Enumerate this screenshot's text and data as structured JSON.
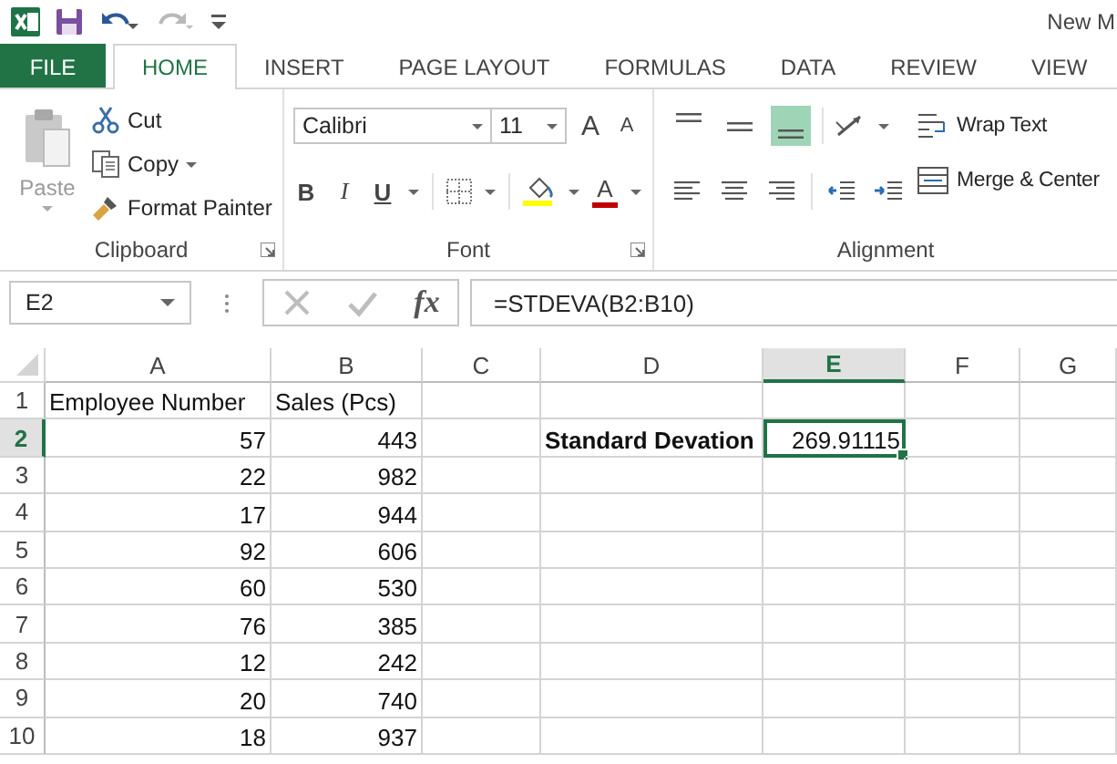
{
  "window": {
    "title": "New M",
    "redo_disabled": true
  },
  "tabs": [
    {
      "label": "FILE",
      "kind": "file",
      "selected": false
    },
    {
      "label": "HOME",
      "kind": "tab",
      "selected": true
    },
    {
      "label": "INSERT",
      "kind": "tab",
      "selected": false
    },
    {
      "label": "PAGE LAYOUT",
      "kind": "tab",
      "selected": false
    },
    {
      "label": "FORMULAS",
      "kind": "tab",
      "selected": false
    },
    {
      "label": "DATA",
      "kind": "tab",
      "selected": false
    },
    {
      "label": "REVIEW",
      "kind": "tab",
      "selected": false
    },
    {
      "label": "VIEW",
      "kind": "tab",
      "selected": false
    }
  ],
  "clipboard": {
    "label": "Clipboard",
    "paste": {
      "label": "Paste",
      "disabled": true
    },
    "cut": "Cut",
    "copy": "Copy",
    "format_painter": "Format Painter"
  },
  "font": {
    "label": "Font",
    "font_name": "Calibri",
    "font_size": "11",
    "grow_glyph": "A",
    "shrink_glyph": "A",
    "bold": "B",
    "italic": "I",
    "underline": "U",
    "color_glyph": "A"
  },
  "alignment": {
    "label": "Alignment",
    "vertical": [
      {
        "kind": "top",
        "selected": false
      },
      {
        "kind": "middle",
        "selected": false
      },
      {
        "kind": "bottom",
        "selected": true
      }
    ],
    "wrap_text": "Wrap Text",
    "merge_center": "Merge & Center"
  },
  "formula_bar": {
    "name_box": "E2",
    "fx": "fx",
    "formula": "=STDEVA(B2:B10)"
  },
  "columns": [
    {
      "label": "A",
      "selected": false
    },
    {
      "label": "B",
      "selected": false
    },
    {
      "label": "C",
      "selected": false
    },
    {
      "label": "D",
      "selected": false
    },
    {
      "label": "E",
      "selected": true
    },
    {
      "label": "F",
      "selected": false
    },
    {
      "label": "G",
      "selected": false
    }
  ],
  "rows": [
    {
      "header": "1",
      "selected": false,
      "cells": [
        {
          "kind": "text",
          "text": "Employee Number"
        },
        {
          "kind": "text",
          "text": "Sales (Pcs)"
        },
        {
          "kind": "empty"
        },
        {
          "kind": "empty"
        },
        {
          "kind": "empty"
        },
        {
          "kind": "empty"
        },
        {
          "kind": "empty"
        }
      ]
    },
    {
      "header": "2",
      "selected": true,
      "cells": [
        {
          "kind": "number",
          "text": "57"
        },
        {
          "kind": "number",
          "text": "443"
        },
        {
          "kind": "empty"
        },
        {
          "kind": "label",
          "text": "Standard Devation"
        },
        {
          "kind": "number",
          "text": "269.91115"
        },
        {
          "kind": "empty"
        },
        {
          "kind": "empty"
        }
      ]
    },
    {
      "header": "3",
      "selected": false,
      "cells": [
        {
          "kind": "number",
          "text": "22"
        },
        {
          "kind": "number",
          "text": "982"
        },
        {
          "kind": "empty"
        },
        {
          "kind": "empty"
        },
        {
          "kind": "empty"
        },
        {
          "kind": "empty"
        },
        {
          "kind": "empty"
        }
      ]
    },
    {
      "header": "4",
      "selected": false,
      "cells": [
        {
          "kind": "number",
          "text": "17"
        },
        {
          "kind": "number",
          "text": "944"
        },
        {
          "kind": "empty"
        },
        {
          "kind": "empty"
        },
        {
          "kind": "empty"
        },
        {
          "kind": "empty"
        },
        {
          "kind": "empty"
        }
      ]
    },
    {
      "header": "5",
      "selected": false,
      "cells": [
        {
          "kind": "number",
          "text": "92"
        },
        {
          "kind": "number",
          "text": "606"
        },
        {
          "kind": "empty"
        },
        {
          "kind": "empty"
        },
        {
          "kind": "empty"
        },
        {
          "kind": "empty"
        },
        {
          "kind": "empty"
        }
      ]
    },
    {
      "header": "6",
      "selected": false,
      "cells": [
        {
          "kind": "number",
          "text": "60"
        },
        {
          "kind": "number",
          "text": "530"
        },
        {
          "kind": "empty"
        },
        {
          "kind": "empty"
        },
        {
          "kind": "empty"
        },
        {
          "kind": "empty"
        },
        {
          "kind": "empty"
        }
      ]
    },
    {
      "header": "7",
      "selected": false,
      "cells": [
        {
          "kind": "number",
          "text": "76"
        },
        {
          "kind": "number",
          "text": "385"
        },
        {
          "kind": "empty"
        },
        {
          "kind": "empty"
        },
        {
          "kind": "empty"
        },
        {
          "kind": "empty"
        },
        {
          "kind": "empty"
        }
      ]
    },
    {
      "header": "8",
      "selected": false,
      "cells": [
        {
          "kind": "number",
          "text": "12"
        },
        {
          "kind": "number",
          "text": "242"
        },
        {
          "kind": "empty"
        },
        {
          "kind": "empty"
        },
        {
          "kind": "empty"
        },
        {
          "kind": "empty"
        },
        {
          "kind": "empty"
        }
      ]
    },
    {
      "header": "9",
      "selected": false,
      "cells": [
        {
          "kind": "number",
          "text": "20"
        },
        {
          "kind": "number",
          "text": "740"
        },
        {
          "kind": "empty"
        },
        {
          "kind": "empty"
        },
        {
          "kind": "empty"
        },
        {
          "kind": "empty"
        },
        {
          "kind": "empty"
        }
      ]
    },
    {
      "header": "10",
      "selected": false,
      "cells": [
        {
          "kind": "number",
          "text": "18"
        },
        {
          "kind": "number",
          "text": "937"
        },
        {
          "kind": "empty"
        },
        {
          "kind": "empty"
        },
        {
          "kind": "empty"
        },
        {
          "kind": "empty"
        },
        {
          "kind": "empty"
        }
      ]
    }
  ]
}
